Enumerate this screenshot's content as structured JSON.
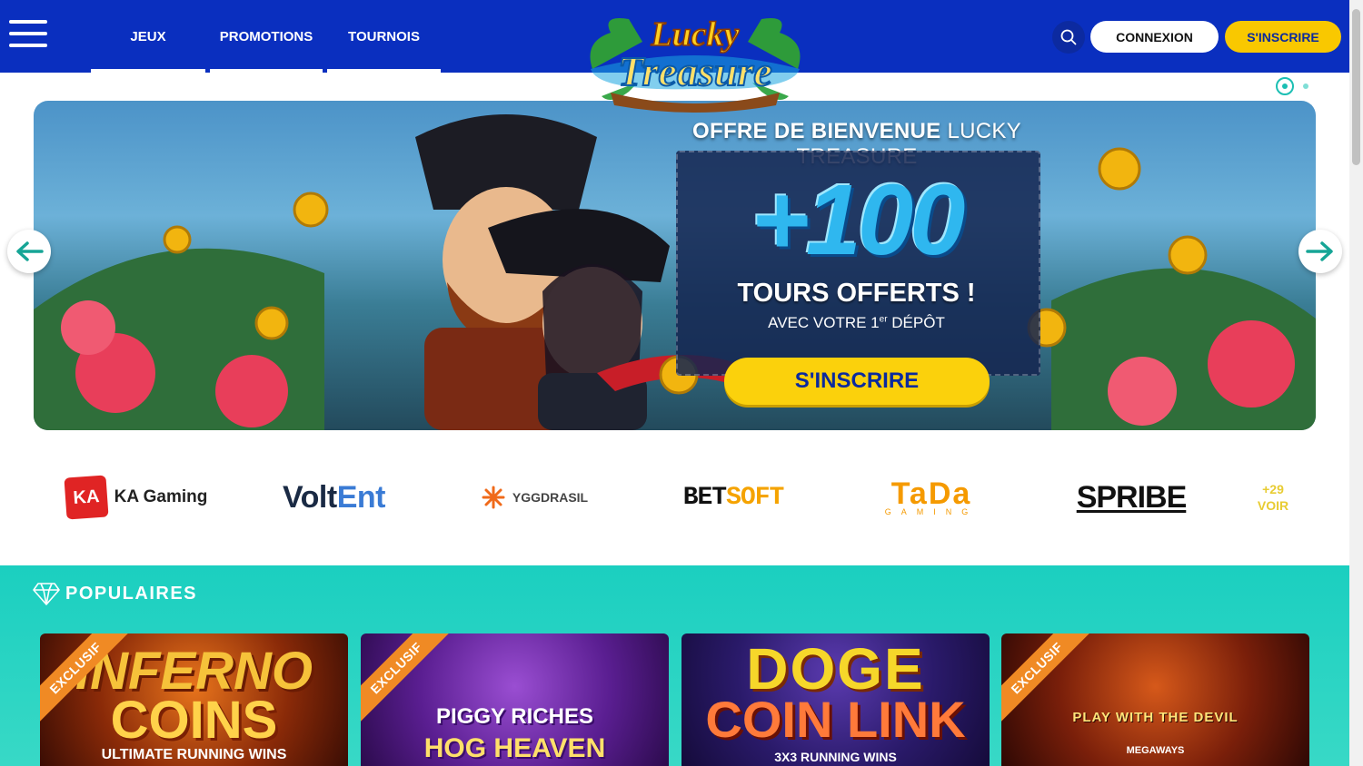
{
  "header": {
    "menu_icon": "hamburger-icon",
    "nav": [
      {
        "label": "JEUX"
      },
      {
        "label": "PROMOTIONS"
      },
      {
        "label": "TOURNOIS"
      }
    ],
    "logo_lines": [
      "Lucky",
      "Treasure"
    ],
    "search_icon": "search-icon",
    "login_label": "CONNEXION",
    "signup_label": "S'INSCRIRE"
  },
  "slider": {
    "slide_count": 2,
    "active_slide": 1
  },
  "banner": {
    "title_bold": "OFFRE DE BIENVENUE",
    "title_light": "LUCKY TREASURE",
    "amount": "+100",
    "subtitle": "TOURS OFFERTS !",
    "detail_prefix": "AVEC VOTRE 1",
    "detail_sup": "er",
    "detail_suffix": "DÉPÔT",
    "cta_label": "S'INSCRIRE",
    "prev_icon": "arrow-left-icon",
    "next_icon": "arrow-right-icon"
  },
  "providers": {
    "ka_mark": "KA",
    "ka_name": "KA Gaming",
    "volt_a": "Volt",
    "volt_b": "Ent",
    "ygg": "YGGDRASIL",
    "bet_a": "BET",
    "bet_b": "SOFT",
    "tada": "TaDa",
    "tada_sub": "GAMING",
    "spribe": "SPRIBE",
    "more_count": "+29",
    "more_label": "VOIR"
  },
  "popular": {
    "title": "POPULAIRES",
    "icon": "diamond-icon",
    "games": [
      {
        "badge": "EXCLUSIF",
        "line1": "INFERNO",
        "line2": "COINS",
        "line3": "ULTIMATE RUNNING WINS"
      },
      {
        "badge": "EXCLUSIF",
        "line1": "PIGGY RICHES",
        "line2": "HOG HEAVEN"
      },
      {
        "line1": "DOGE",
        "line2": "COIN LINK",
        "line3": "3X3 RUNNING WINS"
      },
      {
        "badge": "EXCLUSIF",
        "line1": "PLAY WITH THE DEVIL",
        "line2": "MEGAWAYS"
      }
    ]
  },
  "colors": {
    "header_bg": "#0a2fbf",
    "accent_yellow": "#f9c800",
    "teal": "#1bcfc0",
    "badge_orange": "#f08a24"
  }
}
